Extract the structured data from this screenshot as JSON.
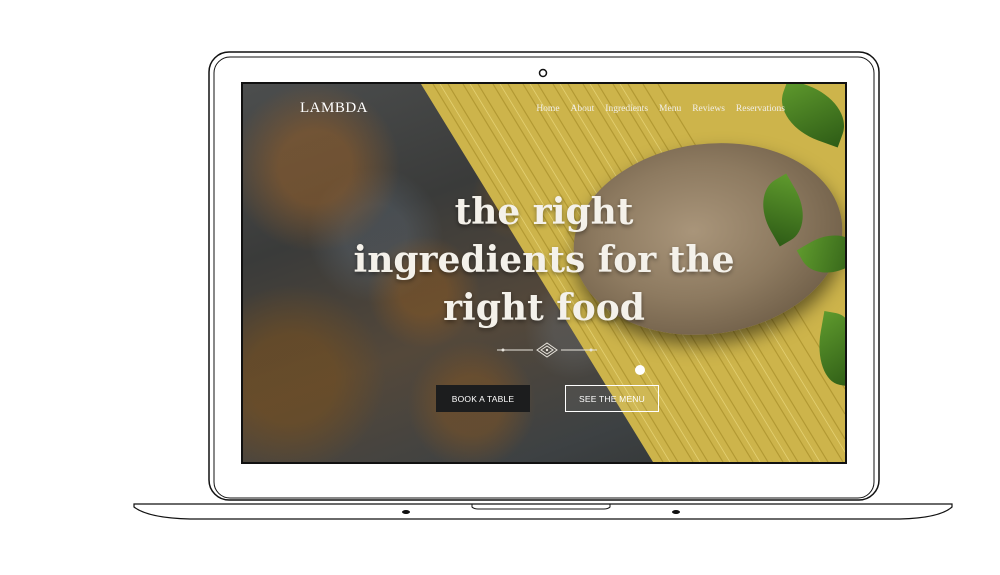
{
  "brand": {
    "logo": "LAMBDA"
  },
  "nav": {
    "items": [
      "Home",
      "About",
      "Ingredients",
      "Menu",
      "Reviews",
      "Reservations"
    ]
  },
  "hero": {
    "headline_lines": [
      "the right",
      "ingredients for the",
      "right food"
    ],
    "primary_button": "BOOK A TABLE",
    "secondary_button": "SEE THE MENU"
  },
  "colors": {
    "text": "#f4f1ea",
    "button_dark": "#1c1d1e",
    "pasta": "#d9c255"
  }
}
